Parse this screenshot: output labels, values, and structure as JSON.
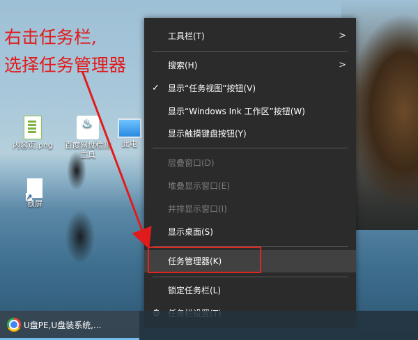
{
  "annotation": {
    "line1": "右击任务栏,",
    "line2": "选择任务管理器"
  },
  "desktop_icons": [
    {
      "label": "内容页.png",
      "icon": "png-file-icon"
    },
    {
      "label": "百度网盘检测工具",
      "icon": "tool-app-icon"
    },
    {
      "label": "此电",
      "icon": "this-pc-icon"
    },
    {
      "label": "锁屏",
      "icon": "shortcut-file-icon"
    }
  ],
  "context_menu": {
    "items": [
      {
        "label": "工具栏(T)",
        "submenu": true,
        "disabled": false
      },
      {
        "label": "搜索(H)",
        "submenu": true,
        "disabled": false
      },
      {
        "label": "显示“任务视图”按钮(V)",
        "checked": true,
        "disabled": false
      },
      {
        "label": "显示“Windows Ink 工作区”按钮(W)",
        "disabled": false
      },
      {
        "label": "显示触摸键盘按钮(Y)",
        "disabled": false
      },
      {
        "label": "层叠窗口(D)",
        "disabled": true
      },
      {
        "label": "堆叠显示窗口(E)",
        "disabled": true
      },
      {
        "label": "并排显示窗口(I)",
        "disabled": true
      },
      {
        "label": "显示桌面(S)",
        "disabled": false
      },
      {
        "label": "任务管理器(K)",
        "highlighted": true,
        "disabled": false
      },
      {
        "label": "锁定任务栏(L)",
        "disabled": false
      },
      {
        "label": "任务栏设置(T)",
        "icon": "gear-icon",
        "disabled": false
      }
    ]
  },
  "taskbar": {
    "active_item": {
      "label": "U盘PE,U盘装系统,...",
      "icon": "chrome-icon"
    }
  },
  "colors": {
    "annotation": "#e11b1b",
    "menu_bg": "#2b2b2b",
    "highlight_box": "#e0261f",
    "taskbar_accent": "#76b9ed"
  }
}
